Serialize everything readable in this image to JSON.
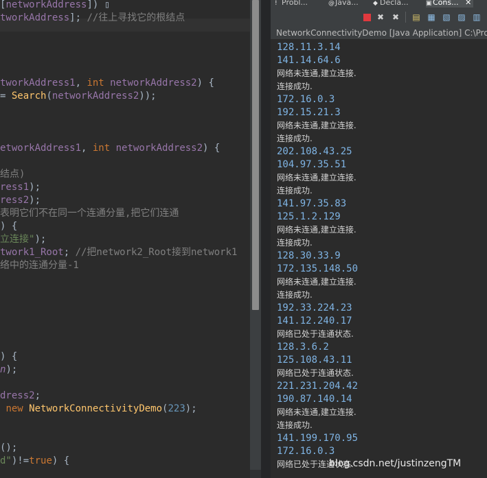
{
  "editor": {
    "lines": [
      {
        "parts": [
          {
            "t": "[",
            "c": ""
          },
          {
            "t": "networkAddress",
            "c": "c-var"
          },
          {
            "t": "]) ",
            "c": ""
          },
          {
            "t": "▯",
            "c": ""
          }
        ]
      },
      {
        "parts": [
          {
            "t": "tworkAddress",
            "c": "c-var"
          },
          {
            "t": "]; ",
            "c": ""
          },
          {
            "t": "//往上寻找它的根结点",
            "c": "c-com"
          }
        ]
      },
      {
        "parts": [
          {
            "t": "",
            "c": ""
          }
        ]
      },
      {
        "parts": [
          {
            "t": "",
            "c": ""
          }
        ]
      },
      {
        "parts": [
          {
            "t": "",
            "c": ""
          }
        ]
      },
      {
        "parts": [
          {
            "t": "",
            "c": ""
          }
        ]
      },
      {
        "parts": [
          {
            "t": "tworkAddress1",
            "c": "c-var"
          },
          {
            "t": ", ",
            "c": ""
          },
          {
            "t": "int",
            "c": "c-kw"
          },
          {
            "t": " ",
            "c": ""
          },
          {
            "t": "networkAddress2",
            "c": "c-var"
          },
          {
            "t": ") {",
            "c": ""
          }
        ]
      },
      {
        "parts": [
          {
            "t": "= ",
            "c": ""
          },
          {
            "t": "Search",
            "c": "c-fn"
          },
          {
            "t": "(",
            "c": ""
          },
          {
            "t": "networkAddress2",
            "c": "c-var"
          },
          {
            "t": "));",
            "c": ""
          }
        ]
      },
      {
        "parts": [
          {
            "t": "",
            "c": ""
          }
        ]
      },
      {
        "parts": [
          {
            "t": "",
            "c": ""
          }
        ]
      },
      {
        "parts": [
          {
            "t": "",
            "c": ""
          }
        ]
      },
      {
        "parts": [
          {
            "t": "etworkAddress1",
            "c": "c-var"
          },
          {
            "t": ", ",
            "c": ""
          },
          {
            "t": "int",
            "c": "c-kw"
          },
          {
            "t": " ",
            "c": ""
          },
          {
            "t": "networkAddress2",
            "c": "c-var"
          },
          {
            "t": ") {",
            "c": ""
          }
        ]
      },
      {
        "parts": [
          {
            "t": "",
            "c": ""
          }
        ]
      },
      {
        "parts": [
          {
            "t": "结点)",
            "c": "c-com"
          }
        ]
      },
      {
        "parts": [
          {
            "t": "ress1",
            "c": "c-var"
          },
          {
            "t": ");",
            "c": ""
          }
        ]
      },
      {
        "parts": [
          {
            "t": "ress2",
            "c": "c-var"
          },
          {
            "t": ");",
            "c": ""
          }
        ]
      },
      {
        "parts": [
          {
            "t": "表明它们不在同一个连通分量,把它们连通",
            "c": "c-com"
          }
        ]
      },
      {
        "parts": [
          {
            "t": ") {",
            "c": ""
          }
        ]
      },
      {
        "parts": [
          {
            "t": "立连接\"",
            "c": "c-str"
          },
          {
            "t": ");",
            "c": ""
          }
        ]
      },
      {
        "parts": [
          {
            "t": "twork1_Root",
            "c": "c-var"
          },
          {
            "t": "; ",
            "c": ""
          },
          {
            "t": "//把network2_Root接到network1",
            "c": "c-com"
          }
        ]
      },
      {
        "parts": [
          {
            "t": "络中的连通分量-1",
            "c": "c-com"
          }
        ]
      },
      {
        "parts": [
          {
            "t": "",
            "c": ""
          }
        ]
      },
      {
        "parts": [
          {
            "t": "",
            "c": ""
          }
        ]
      },
      {
        "parts": [
          {
            "t": "",
            "c": ""
          }
        ]
      },
      {
        "parts": [
          {
            "t": "",
            "c": ""
          }
        ]
      },
      {
        "parts": [
          {
            "t": "",
            "c": ""
          }
        ]
      },
      {
        "parts": [
          {
            "t": "",
            "c": ""
          }
        ]
      },
      {
        "parts": [
          {
            "t": ") {",
            "c": ""
          }
        ]
      },
      {
        "parts": [
          {
            "t": "n",
            "c": "c-var c-ital"
          },
          {
            "t": ");",
            "c": ""
          }
        ]
      },
      {
        "parts": [
          {
            "t": "",
            "c": ""
          }
        ]
      },
      {
        "parts": [
          {
            "t": "dress2",
            "c": "c-var"
          },
          {
            "t": ";",
            "c": ""
          }
        ]
      },
      {
        "parts": [
          {
            "t": " ",
            "c": ""
          },
          {
            "t": "new",
            "c": "c-kw"
          },
          {
            "t": " ",
            "c": ""
          },
          {
            "t": "NetworkConnectivityDemo",
            "c": "c-fn"
          },
          {
            "t": "(",
            "c": ""
          },
          {
            "t": "223",
            "c": "c-num"
          },
          {
            "t": ");",
            "c": ""
          }
        ]
      },
      {
        "parts": [
          {
            "t": "",
            "c": ""
          }
        ]
      },
      {
        "parts": [
          {
            "t": "",
            "c": ""
          }
        ]
      },
      {
        "parts": [
          {
            "t": "();",
            "c": ""
          }
        ]
      },
      {
        "parts": [
          {
            "t": "d\"",
            "c": "c-str"
          },
          {
            "t": ")!=",
            "c": ""
          },
          {
            "t": "true",
            "c": "c-kw"
          },
          {
            "t": ") {",
            "c": ""
          }
        ]
      }
    ]
  },
  "console": {
    "tabs": [
      {
        "icon": "!",
        "label": "Probl..."
      },
      {
        "icon": "@",
        "label": "Java..."
      },
      {
        "icon": "◆",
        "label": "Decla..."
      },
      {
        "icon": "▣",
        "label": "Cons..."
      }
    ],
    "close_symbol": "✕",
    "title": "NetworkConnectivityDemo [Java Application] C:\\Prog",
    "output": [
      {
        "type": "ip",
        "text": "128.11.3.14"
      },
      {
        "type": "ip",
        "text": "141.14.64.6"
      },
      {
        "type": "msg",
        "text": "网络未连通,建立连接."
      },
      {
        "type": "msg",
        "text": "连接成功."
      },
      {
        "type": "ip",
        "text": "172.16.0.3"
      },
      {
        "type": "ip",
        "text": "192.15.21.3"
      },
      {
        "type": "msg",
        "text": "网络未连通,建立连接."
      },
      {
        "type": "msg",
        "text": "连接成功."
      },
      {
        "type": "ip",
        "text": "202.108.43.25"
      },
      {
        "type": "ip",
        "text": "104.97.35.51"
      },
      {
        "type": "msg",
        "text": "网络未连通,建立连接."
      },
      {
        "type": "msg",
        "text": "连接成功."
      },
      {
        "type": "ip",
        "text": "141.97.35.83"
      },
      {
        "type": "ip",
        "text": "125.1.2.129"
      },
      {
        "type": "msg",
        "text": "网络未连通,建立连接."
      },
      {
        "type": "msg",
        "text": "连接成功."
      },
      {
        "type": "ip",
        "text": "128.30.33.9"
      },
      {
        "type": "ip",
        "text": "172.135.148.50"
      },
      {
        "type": "msg",
        "text": "网络未连通,建立连接."
      },
      {
        "type": "msg",
        "text": "连接成功."
      },
      {
        "type": "ip",
        "text": "192.33.224.23"
      },
      {
        "type": "ip",
        "text": "141.12.240.17"
      },
      {
        "type": "msg",
        "text": "网络已处于连通状态."
      },
      {
        "type": "ip",
        "text": "128.3.6.2"
      },
      {
        "type": "ip",
        "text": "125.108.43.11"
      },
      {
        "type": "msg",
        "text": "网络已处于连通状态."
      },
      {
        "type": "ip",
        "text": "221.231.204.42"
      },
      {
        "type": "ip",
        "text": "190.87.140.14"
      },
      {
        "type": "msg",
        "text": "网络未连通,建立连接."
      },
      {
        "type": "msg",
        "text": "连接成功."
      },
      {
        "type": "ip",
        "text": "141.199.170.95"
      },
      {
        "type": "ip",
        "text": "172.16.0.3"
      },
      {
        "type": "msg",
        "text": "网络已处于连通状态."
      }
    ],
    "watermark": "blog.csdn.net/justinzengTM"
  },
  "colors": {
    "terminate_button": "#e0393e"
  }
}
